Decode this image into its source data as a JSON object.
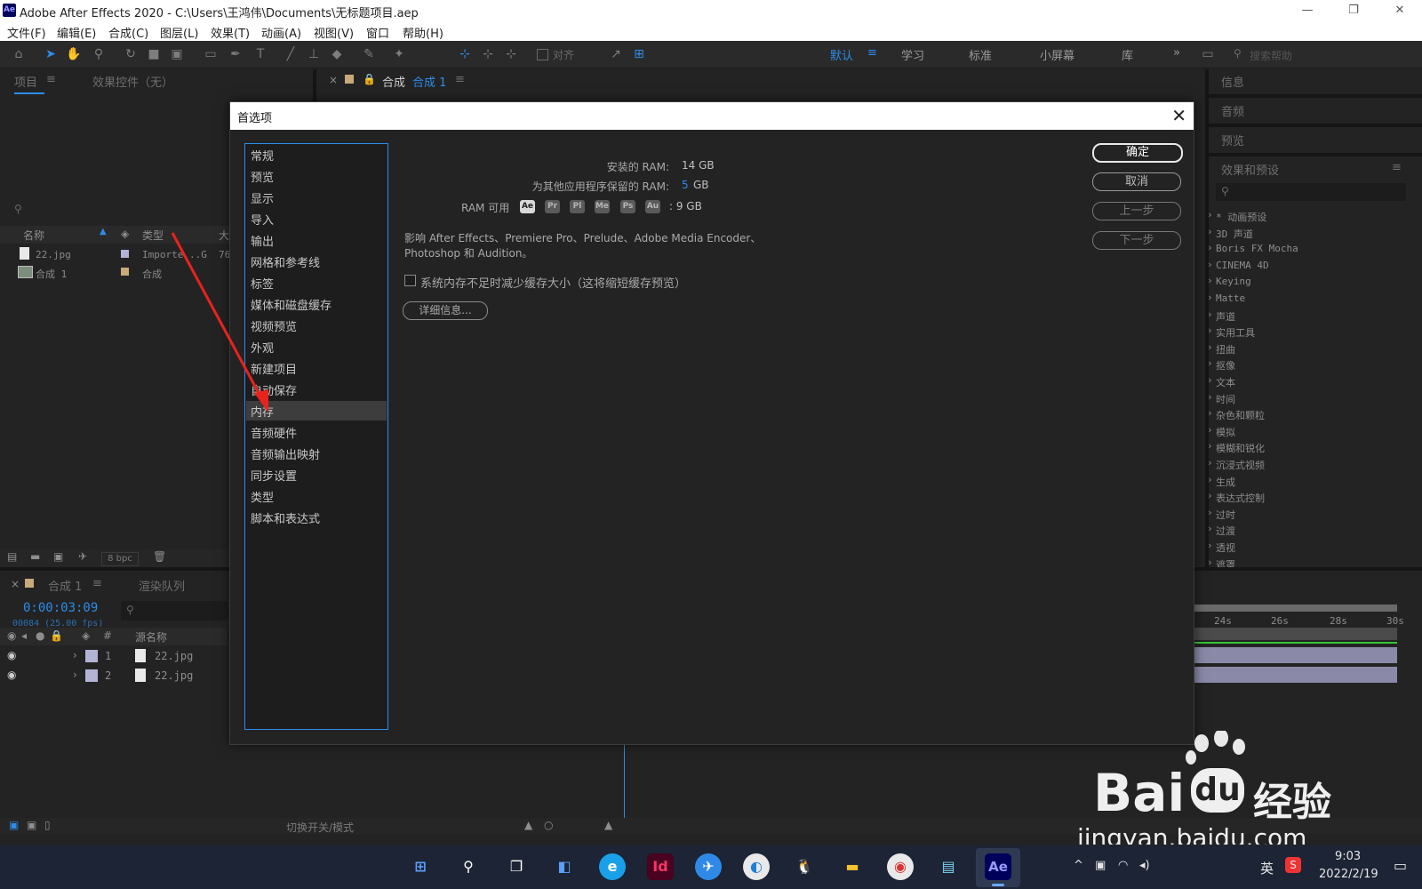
{
  "window": {
    "app_icon": "Ae",
    "title": "Adobe After Effects 2020 - C:\\Users\\王鸿伟\\Documents\\无标题项目.aep"
  },
  "menu": [
    "文件(F)",
    "编辑(E)",
    "合成(C)",
    "图层(L)",
    "效果(T)",
    "动画(A)",
    "视图(V)",
    "窗口",
    "帮助(H)"
  ],
  "toolbar": {
    "align_label": "对齐",
    "workspaces": [
      "默认",
      "学习",
      "标准",
      "小屏幕",
      "库"
    ],
    "search_placeholder": "搜索帮助"
  },
  "project_panel": {
    "tab_project": "项目",
    "tab_effect_controls": "效果控件（无）",
    "columns": [
      "名称",
      "类型",
      "大"
    ],
    "items": [
      {
        "name": "22.jpg",
        "type": "Importe...G",
        "size": "76"
      },
      {
        "name": "合成 1",
        "type": "合成",
        "size": ""
      }
    ],
    "bpc": "8 bpc"
  },
  "comp_panel": {
    "tab_prefix": "合成",
    "tab_name": "合成 1"
  },
  "right_panels": {
    "info": "信息",
    "audio": "音频",
    "preview": "预览",
    "effects_presets": "效果和预设",
    "effects": [
      "* 动画预设",
      "3D 声道",
      "Boris FX Mocha",
      "CINEMA 4D",
      "Keying",
      "Matte",
      "声道",
      "实用工具",
      "扭曲",
      "抠像",
      "文本",
      "时间",
      "杂色和颗粒",
      "模拟",
      "模糊和锐化",
      "沉浸式视频",
      "生成",
      "表达式控制",
      "过时",
      "过渡",
      "透视",
      "遮罩"
    ]
  },
  "timeline": {
    "tab_comp": "合成 1",
    "tab_render": "渲染队列",
    "timecode": "0:00:03:09",
    "frames": "00084 (25.00 fps)",
    "col_source": "源名称",
    "col_num": "#",
    "layers": [
      {
        "num": "1",
        "name": "22.jpg"
      },
      {
        "num": "2",
        "name": "22.jpg"
      }
    ],
    "ruler": [
      "24s",
      "26s",
      "28s",
      "30s"
    ],
    "toggle_label": "切换开关/模式"
  },
  "dialog": {
    "title": "首选项",
    "categories": [
      "常规",
      "预览",
      "显示",
      "导入",
      "输出",
      "网格和参考线",
      "标签",
      "媒体和磁盘缓存",
      "视频预览",
      "外观",
      "新建项目",
      "自动保存",
      "内存",
      "音频硬件",
      "音频输出映射",
      "同步设置",
      "类型",
      "脚本和表达式"
    ],
    "selected_index": 12,
    "installed_ram_label": "安装的 RAM:",
    "installed_ram_value": "14 GB",
    "reserved_label": "为其他应用程序保留的 RAM:",
    "reserved_value": "5",
    "reserved_unit": "GB",
    "available_label": "RAM 可用",
    "apps": [
      "Ae",
      "Pr",
      "Pl",
      "Me",
      "Ps",
      "Au"
    ],
    "available_value": "9 GB",
    "affects_text_line1": "影响 After Effects、Premiere Pro、Prelude、Adobe Media Encoder、",
    "affects_text_line2": "Photoshop 和 Audition。",
    "checkbox_label": "系统内存不足时减少缓存大小（这将缩短缓存预览）",
    "details_button": "详细信息...",
    "buttons": {
      "ok": "确定",
      "cancel": "取消",
      "prev": "上一步",
      "next": "下一步"
    }
  },
  "taskbar": {
    "ime": "英",
    "time": "9:03",
    "date": "2022/2/19"
  },
  "watermark": {
    "brand": "Bai",
    "brand2": "du",
    "brand3": "经验",
    "url": "jingyan.baidu.com"
  },
  "colors": {
    "accent_blue": "#2d8ceb",
    "dialog_bg": "#232323",
    "arrow_red": "#e8231e"
  }
}
